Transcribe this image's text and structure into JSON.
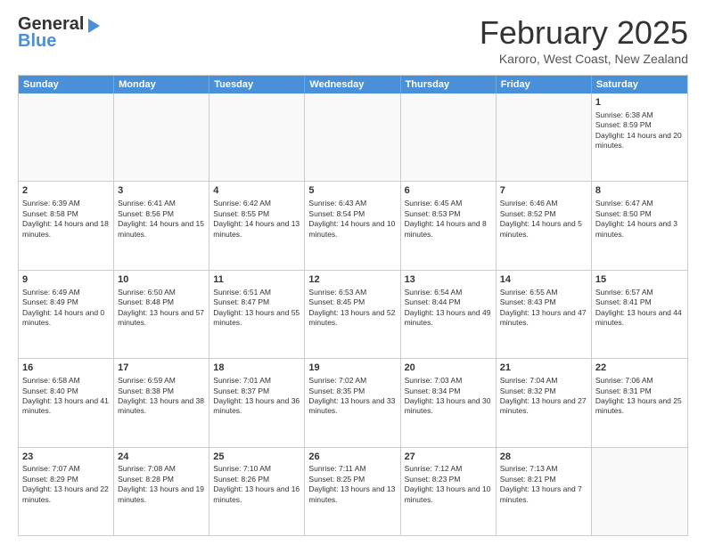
{
  "logo": {
    "general": "General",
    "blue": "Blue"
  },
  "header": {
    "month": "February 2025",
    "location": "Karoro, West Coast, New Zealand"
  },
  "days": [
    "Sunday",
    "Monday",
    "Tuesday",
    "Wednesday",
    "Thursday",
    "Friday",
    "Saturday"
  ],
  "weeks": [
    [
      {
        "day": "",
        "text": ""
      },
      {
        "day": "",
        "text": ""
      },
      {
        "day": "",
        "text": ""
      },
      {
        "day": "",
        "text": ""
      },
      {
        "day": "",
        "text": ""
      },
      {
        "day": "",
        "text": ""
      },
      {
        "day": "1",
        "text": "Sunrise: 6:38 AM\nSunset: 8:59 PM\nDaylight: 14 hours and 20 minutes."
      }
    ],
    [
      {
        "day": "2",
        "text": "Sunrise: 6:39 AM\nSunset: 8:58 PM\nDaylight: 14 hours and 18 minutes."
      },
      {
        "day": "3",
        "text": "Sunrise: 6:41 AM\nSunset: 8:56 PM\nDaylight: 14 hours and 15 minutes."
      },
      {
        "day": "4",
        "text": "Sunrise: 6:42 AM\nSunset: 8:55 PM\nDaylight: 14 hours and 13 minutes."
      },
      {
        "day": "5",
        "text": "Sunrise: 6:43 AM\nSunset: 8:54 PM\nDaylight: 14 hours and 10 minutes."
      },
      {
        "day": "6",
        "text": "Sunrise: 6:45 AM\nSunset: 8:53 PM\nDaylight: 14 hours and 8 minutes."
      },
      {
        "day": "7",
        "text": "Sunrise: 6:46 AM\nSunset: 8:52 PM\nDaylight: 14 hours and 5 minutes."
      },
      {
        "day": "8",
        "text": "Sunrise: 6:47 AM\nSunset: 8:50 PM\nDaylight: 14 hours and 3 minutes."
      }
    ],
    [
      {
        "day": "9",
        "text": "Sunrise: 6:49 AM\nSunset: 8:49 PM\nDaylight: 14 hours and 0 minutes."
      },
      {
        "day": "10",
        "text": "Sunrise: 6:50 AM\nSunset: 8:48 PM\nDaylight: 13 hours and 57 minutes."
      },
      {
        "day": "11",
        "text": "Sunrise: 6:51 AM\nSunset: 8:47 PM\nDaylight: 13 hours and 55 minutes."
      },
      {
        "day": "12",
        "text": "Sunrise: 6:53 AM\nSunset: 8:45 PM\nDaylight: 13 hours and 52 minutes."
      },
      {
        "day": "13",
        "text": "Sunrise: 6:54 AM\nSunset: 8:44 PM\nDaylight: 13 hours and 49 minutes."
      },
      {
        "day": "14",
        "text": "Sunrise: 6:55 AM\nSunset: 8:43 PM\nDaylight: 13 hours and 47 minutes."
      },
      {
        "day": "15",
        "text": "Sunrise: 6:57 AM\nSunset: 8:41 PM\nDaylight: 13 hours and 44 minutes."
      }
    ],
    [
      {
        "day": "16",
        "text": "Sunrise: 6:58 AM\nSunset: 8:40 PM\nDaylight: 13 hours and 41 minutes."
      },
      {
        "day": "17",
        "text": "Sunrise: 6:59 AM\nSunset: 8:38 PM\nDaylight: 13 hours and 38 minutes."
      },
      {
        "day": "18",
        "text": "Sunrise: 7:01 AM\nSunset: 8:37 PM\nDaylight: 13 hours and 36 minutes."
      },
      {
        "day": "19",
        "text": "Sunrise: 7:02 AM\nSunset: 8:35 PM\nDaylight: 13 hours and 33 minutes."
      },
      {
        "day": "20",
        "text": "Sunrise: 7:03 AM\nSunset: 8:34 PM\nDaylight: 13 hours and 30 minutes."
      },
      {
        "day": "21",
        "text": "Sunrise: 7:04 AM\nSunset: 8:32 PM\nDaylight: 13 hours and 27 minutes."
      },
      {
        "day": "22",
        "text": "Sunrise: 7:06 AM\nSunset: 8:31 PM\nDaylight: 13 hours and 25 minutes."
      }
    ],
    [
      {
        "day": "23",
        "text": "Sunrise: 7:07 AM\nSunset: 8:29 PM\nDaylight: 13 hours and 22 minutes."
      },
      {
        "day": "24",
        "text": "Sunrise: 7:08 AM\nSunset: 8:28 PM\nDaylight: 13 hours and 19 minutes."
      },
      {
        "day": "25",
        "text": "Sunrise: 7:10 AM\nSunset: 8:26 PM\nDaylight: 13 hours and 16 minutes."
      },
      {
        "day": "26",
        "text": "Sunrise: 7:11 AM\nSunset: 8:25 PM\nDaylight: 13 hours and 13 minutes."
      },
      {
        "day": "27",
        "text": "Sunrise: 7:12 AM\nSunset: 8:23 PM\nDaylight: 13 hours and 10 minutes."
      },
      {
        "day": "28",
        "text": "Sunrise: 7:13 AM\nSunset: 8:21 PM\nDaylight: 13 hours and 7 minutes."
      },
      {
        "day": "",
        "text": ""
      }
    ]
  ]
}
